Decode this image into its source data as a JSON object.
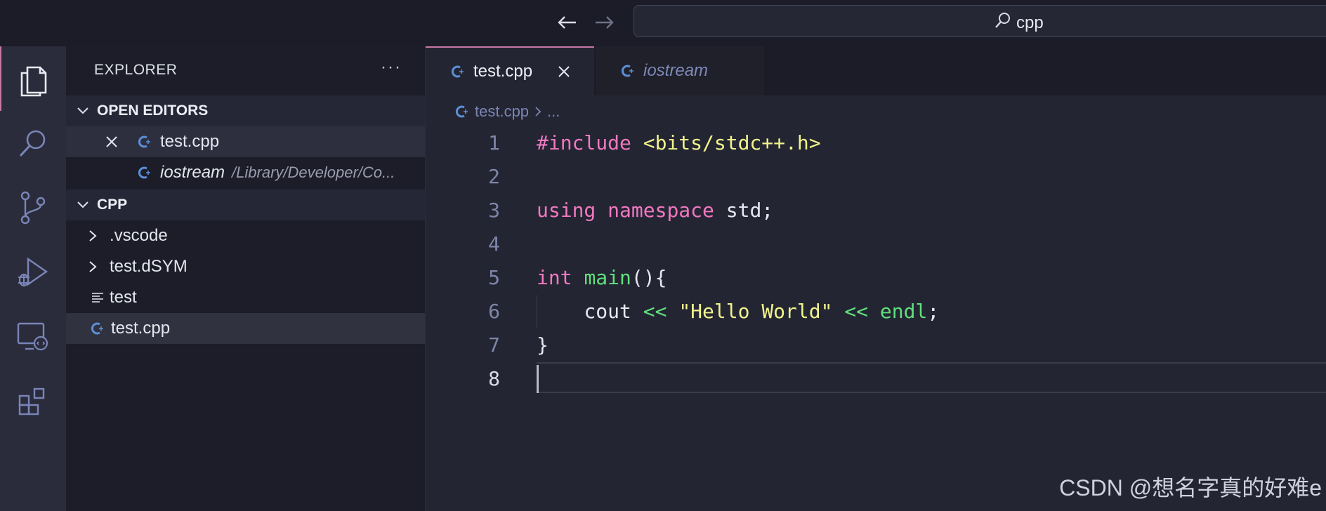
{
  "search": {
    "query": "cpp"
  },
  "sidebar": {
    "title": "EXPLORER",
    "more": "···",
    "open_editors_label": "OPEN EDITORS",
    "open_editors": [
      {
        "name": "test.cpp",
        "desc": ""
      },
      {
        "name": "iostream",
        "desc": "/Library/Developer/Co..."
      }
    ],
    "folder_label": "CPP",
    "files": [
      {
        "name": ".vscode"
      },
      {
        "name": "test.dSYM"
      },
      {
        "name": "test"
      },
      {
        "name": "test.cpp"
      }
    ]
  },
  "tabs": [
    {
      "label": "test.cpp"
    },
    {
      "label": "iostream"
    }
  ],
  "breadcrumb": {
    "file": "test.cpp",
    "rest": "..."
  },
  "code": {
    "line_numbers": [
      "1",
      "2",
      "3",
      "4",
      "5",
      "6",
      "7",
      "8"
    ],
    "l1": {
      "directive": "#include",
      "header": "<bits/stdc++.h>"
    },
    "l3": {
      "using": "using",
      "namespace": "namespace",
      "rest": " std;"
    },
    "l5": {
      "type": "int",
      "fn": "main",
      "rest": "(){"
    },
    "l6": {
      "indent": "    ",
      "cout": "cout",
      "op1": "<<",
      "str": "\"Hello World\"",
      "op2": "<<",
      "endl": "endl",
      "semi": ";"
    },
    "l7": {
      "text": "}"
    }
  },
  "watermark": "CSDN @想名字真的好难e",
  "colors": {
    "accent": "#c678a6",
    "keyword": "#f178c0",
    "function": "#5fe07c",
    "string": "#f1f48c",
    "cpp_icon": "#5b8fd6"
  }
}
